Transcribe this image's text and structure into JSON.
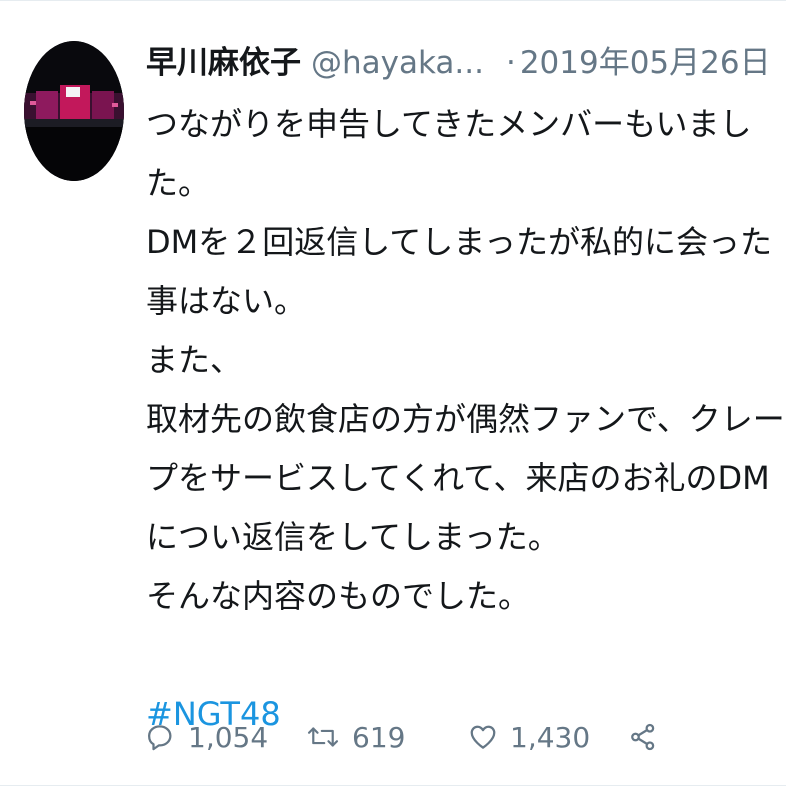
{
  "tweet": {
    "author_name": "早川麻依子",
    "handle": "@hayaka...",
    "separator": "·",
    "date": "2019年05月26日",
    "caret": "∨",
    "lines": [
      "つながりを申告してきたメンバーもいまし",
      "た。",
      "DMを２回返信してしまったが私的に会った",
      "事はない。",
      "また、",
      "取材先の飲食店の方が偶然ファンで、クレー",
      "プをサービスしてくれて、来店のお礼のDM",
      "につい返信をしてしまった。",
      "そんな内容のものでした。"
    ],
    "hashtag": "#NGT48"
  },
  "actions": {
    "reply_icon": "reply-icon",
    "reply_count": "1,054",
    "retweet_icon": "retweet-icon",
    "retweet_count": "619",
    "like_icon": "heart-icon",
    "like_count": "1,430",
    "share_icon": "share-icon"
  },
  "colors": {
    "text": "#14171a",
    "secondary": "#657786",
    "link": "#1b95e0",
    "avatar_stage": "#c2185b"
  }
}
